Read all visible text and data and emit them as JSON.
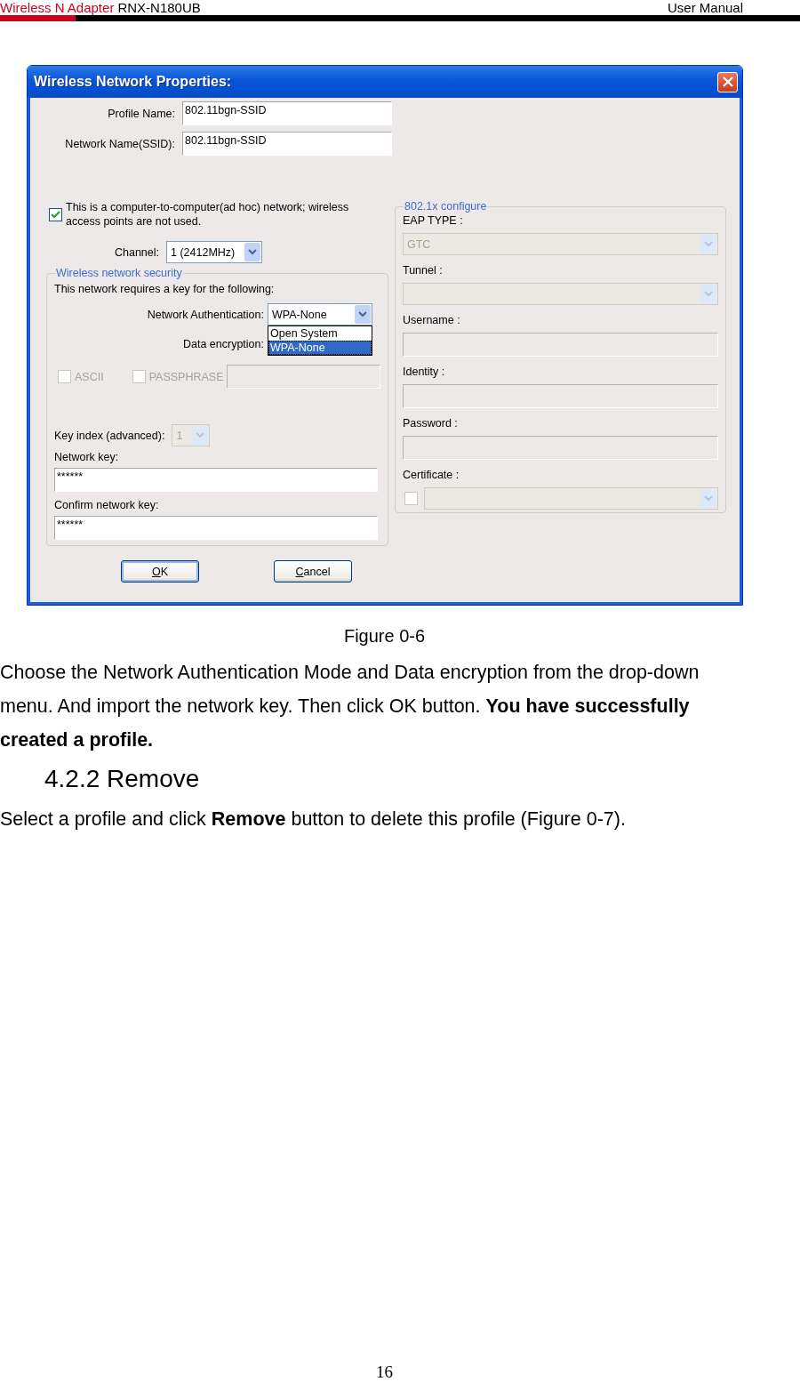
{
  "header": {
    "product": "Wireless N Adapter",
    "model": "RNX-N180UB",
    "document": "User Manual"
  },
  "dialog": {
    "title": "Wireless Network Properties:",
    "profile_name": {
      "label": "Profile Name:",
      "value": "802.11bgn-SSID"
    },
    "network_name": {
      "label": "Network Name(SSID):",
      "value": "802.11bgn-SSID"
    },
    "adhoc": {
      "label": "This is a computer-to-computer(ad hoc) network; wireless access points are not used.",
      "checked": true
    },
    "channel": {
      "label": "Channel:",
      "value": "1  (2412MHz)"
    },
    "security": {
      "legend": "Wireless network security",
      "intro": "This network requires a key for the following:",
      "authentication": {
        "label": "Network Authentication:",
        "value": "WPA-None",
        "expanded": true,
        "options": [
          {
            "label": "Open System",
            "selected": false
          },
          {
            "label": "WPA-None",
            "selected": true
          }
        ]
      },
      "encryption": {
        "label": "Data encryption:"
      },
      "ascii": {
        "label": "ASCII",
        "checked": false,
        "disabled": true
      },
      "passphrase": {
        "label": "PASSPHRASE",
        "checked": false,
        "disabled": true
      },
      "key_index": {
        "label": "Key index (advanced):",
        "value": "1",
        "disabled": true
      },
      "network_key": {
        "label": "Network key:",
        "value": "******"
      },
      "confirm_key": {
        "label": "Confirm network key:",
        "value": "******"
      }
    },
    "eap": {
      "legend": "802.1x configure",
      "fields": [
        {
          "kind": "select",
          "label": "EAP TYPE :",
          "value": "GTC",
          "disabled": true
        },
        {
          "kind": "select",
          "label": "Tunnel :",
          "disabled": true
        },
        {
          "kind": "input",
          "label": "Username :",
          "disabled": true
        },
        {
          "kind": "input",
          "label": "Identity :",
          "disabled": true
        },
        {
          "kind": "input",
          "label": "Password :",
          "disabled": true
        },
        {
          "kind": "checkselect",
          "label": "Certificate :",
          "checked": false,
          "disabled": true
        }
      ]
    },
    "buttons": [
      {
        "label": "OK",
        "default": true
      },
      {
        "label": "Cancel",
        "default": false
      }
    ]
  },
  "caption": "Figure 0-6",
  "paragraph_1": "Choose the Network Authentication Mode and Data encryption from the drop-down menu. And import the network key. Then click OK button. **You have successfully created a profile.**",
  "heading": "4.2.2 Remove",
  "paragraph_2": "Select a profile and click **Remove** button to delete this profile (Figure 0-7).",
  "page_number": "16"
}
